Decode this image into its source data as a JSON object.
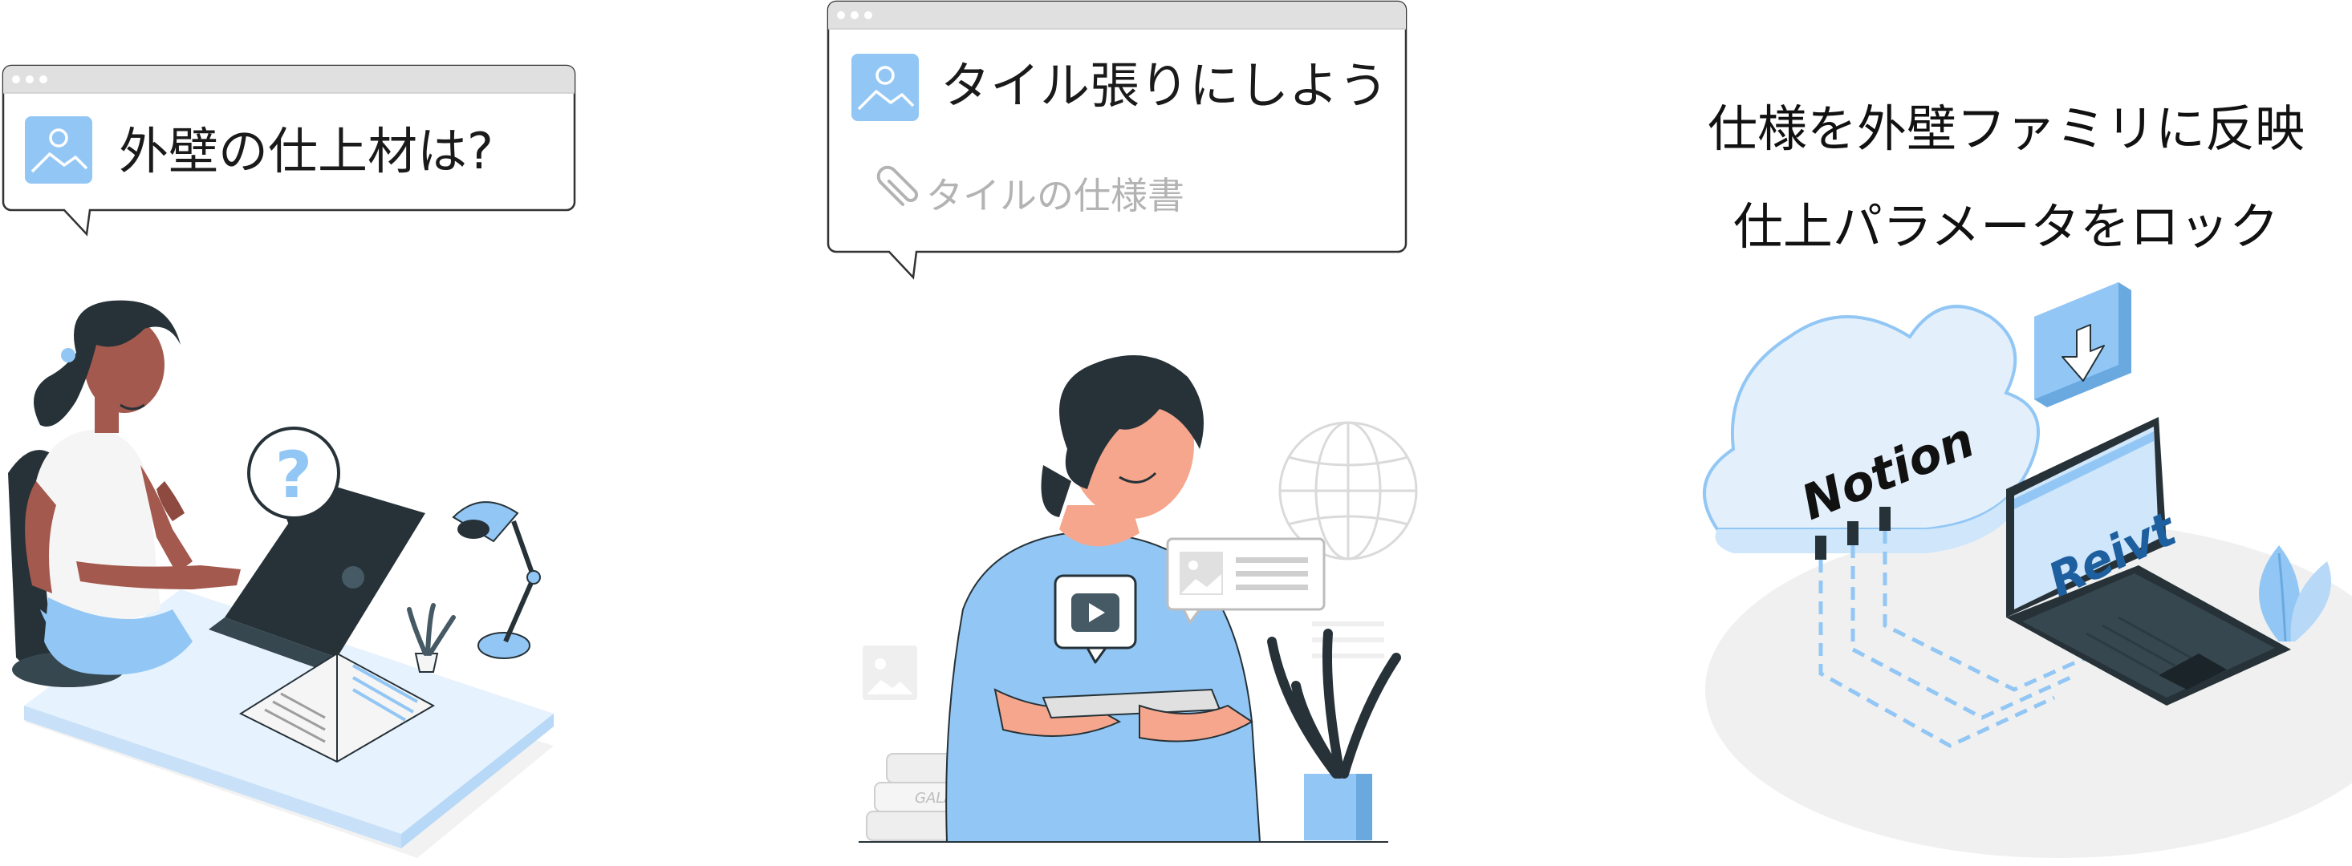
{
  "panels": {
    "left": {
      "bubble_text": "外壁の仕上材は?",
      "question_mark": "?"
    },
    "center": {
      "bubble_text": "タイル張りにしよう",
      "attachment_text": "タイルの仕様書",
      "book_spine_text": "GALAXY"
    },
    "right": {
      "caption_line1": "仕様を外壁ファミリに反映",
      "caption_line2": "仕上パラメータをロック",
      "cloud_label": "Notion",
      "laptop_label": "Reivt"
    }
  },
  "colors": {
    "accent_blue": "#92c7f5",
    "dark_navy": "#263238",
    "light_blue": "#cfe6fb",
    "pale_gray": "#f0f0f0",
    "bubble_border": "#333333",
    "bubble_bar": "#e0e0e0"
  },
  "icons": [
    "image-icon",
    "paperclip-icon",
    "question-icon",
    "play-icon",
    "globe-icon",
    "download-arrow-icon"
  ]
}
